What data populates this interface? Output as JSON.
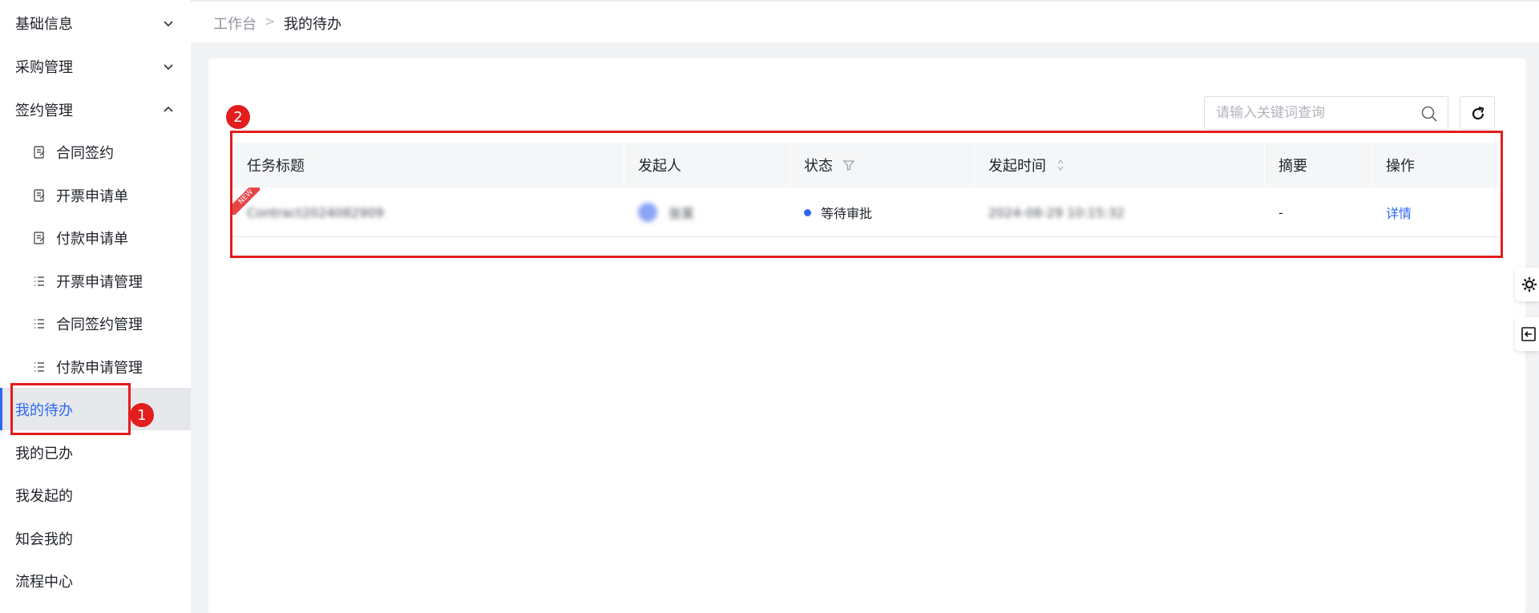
{
  "sidebar": {
    "items": [
      {
        "label": "基础信息",
        "type": "group",
        "expanded": false
      },
      {
        "label": "采购管理",
        "type": "group",
        "expanded": false
      },
      {
        "label": "签约管理",
        "type": "group",
        "expanded": true
      },
      {
        "label": "合同签约",
        "type": "sub",
        "icon": "form-icon"
      },
      {
        "label": "开票申请单",
        "type": "sub",
        "icon": "form-icon"
      },
      {
        "label": "付款申请单",
        "type": "sub",
        "icon": "form-icon"
      },
      {
        "label": "开票申请管理",
        "type": "sub",
        "icon": "list-icon"
      },
      {
        "label": "合同签约管理",
        "type": "sub",
        "icon": "list-icon"
      },
      {
        "label": "付款申请管理",
        "type": "sub",
        "icon": "list-icon"
      },
      {
        "label": "我的待办",
        "type": "item",
        "active": true
      },
      {
        "label": "我的已办",
        "type": "item"
      },
      {
        "label": "我发起的",
        "type": "item"
      },
      {
        "label": "知会我的",
        "type": "item"
      },
      {
        "label": "流程中心",
        "type": "item"
      }
    ]
  },
  "breadcrumb": {
    "home": "工作台",
    "separator": ">",
    "current": "我的待办"
  },
  "search": {
    "placeholder": "请输入关键词查询",
    "value": ""
  },
  "table": {
    "columns": [
      "任务标题",
      "发起人",
      "状态",
      "发起时间",
      "摘要",
      "操作"
    ],
    "rows": [
      {
        "title": "Contract2024082909",
        "initiator": "张某",
        "status": "等待审批",
        "time": "2024-08-29 10:15:32",
        "summary": "-",
        "action": "详情",
        "badge": "NEW"
      }
    ]
  },
  "annotations": [
    "1",
    "2"
  ],
  "colors": {
    "accent": "#2e67f5",
    "annotation": "#e31d1d",
    "active_bg": "#e6e8eb"
  }
}
